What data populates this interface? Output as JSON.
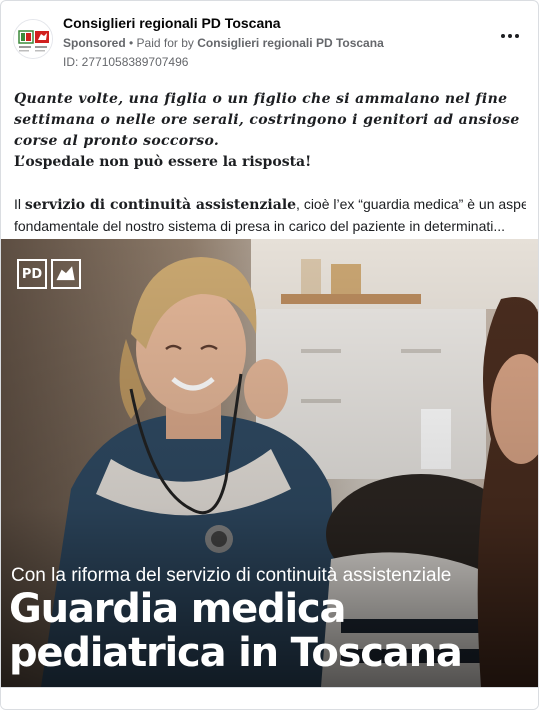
{
  "header": {
    "page_name": "Consiglieri regionali PD Toscana",
    "sponsored": "Sponsored",
    "separator": " • ",
    "paid_for_by": "Paid for by ",
    "payer": "Consiglieri regionali PD Toscana",
    "ad_id": "ID: 2771058389707496"
  },
  "body": {
    "paragraph1": "Quante volte, una figlia o un figlio che si ammalano nel fine settimana o nelle ore serali, costringono i genitori ad ansiose corse al pronto soccorso.",
    "paragraph2": "L’ospedale non può essere la risposta!",
    "paragraph3_prefix": "Il ",
    "paragraph3_bold": "servizio di continuità assistenziale",
    "paragraph3_rest": ", cioè l’ex “guardia medica” è un aspetto",
    "paragraph3_line2": "fondamentale del nostro sistema di presa in carico del paziente in determinati..."
  },
  "image": {
    "logo_pd": "PD",
    "subtitle": "Con la riforma del servizio di continuità assistenziale",
    "title_line1": "Guardia medica",
    "title_line2": "pediatrica in Toscana"
  },
  "colors": {
    "text_primary": "#050505",
    "text_secondary": "#65676b",
    "card_border": "#dadde1"
  },
  "icons": {
    "more": "more-horizontal-icon",
    "avatar": "pd-toscana-logo"
  }
}
